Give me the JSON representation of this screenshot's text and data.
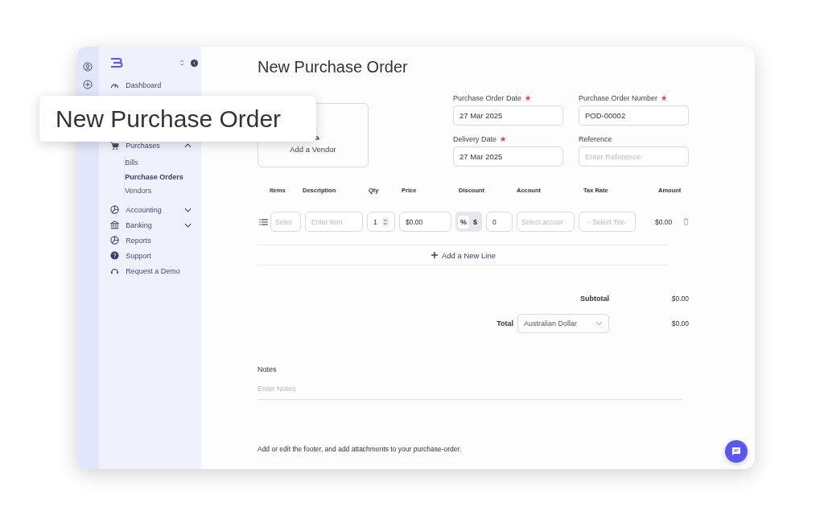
{
  "callout": {
    "title": "New Purchase Order"
  },
  "sidebar": {
    "items": [
      {
        "label": "Dashboard"
      },
      {
        "label": "Purchases",
        "expanded": true,
        "children": [
          {
            "label": "Bills",
            "selected": false
          },
          {
            "label": "Purchase Orders",
            "selected": true
          },
          {
            "label": "Vendors",
            "selected": false
          }
        ]
      },
      {
        "label": "Accounting",
        "expanded": false
      },
      {
        "label": "Banking",
        "expanded": false
      },
      {
        "label": "Reports"
      },
      {
        "label": "Support"
      },
      {
        "label": "Request a Demo"
      }
    ]
  },
  "page": {
    "title": "New Purchase Order"
  },
  "vendor": {
    "label": "Add a Vendor"
  },
  "fields": [
    {
      "label": "Purchase Order Date",
      "required_mark": "*",
      "value": "27 Mar 2025"
    },
    {
      "label": "Purchase Order Number",
      "required_mark": "*",
      "value": "POD-00002"
    },
    {
      "label": "Delivery Date",
      "required_mark": "*",
      "value": "27 Mar 2025"
    },
    {
      "label": "Reference",
      "placeholder": "Enter Reference"
    }
  ],
  "table": {
    "columns": [
      "Items",
      "Description",
      "Qty",
      "Price",
      "Discount",
      "Account",
      "Tax Rate",
      "Amount"
    ],
    "row": {
      "item_placeholder": "Selec",
      "description_placeholder": "Enter item",
      "qty": "1",
      "price": "$0.00",
      "discount_types": [
        {
          "label": "%",
          "selected": true
        },
        {
          "label": "$",
          "selected": false
        }
      ],
      "discount": "0",
      "account_placeholder": "Select accour",
      "tax_placeholder": "- Select Tax-",
      "amount": "$0.00"
    },
    "add_line": "Add a New Line"
  },
  "totals": {
    "subtotal_label": "Subtotal",
    "subtotal": "$0.00",
    "total_label": "Total",
    "currency": "Australian Dollar",
    "total": "$0.00"
  },
  "notes": {
    "label": "Notes",
    "placeholder": "Enter Notes"
  },
  "footer": "Add or edit the footer, and add attachments to your purchase-order."
}
